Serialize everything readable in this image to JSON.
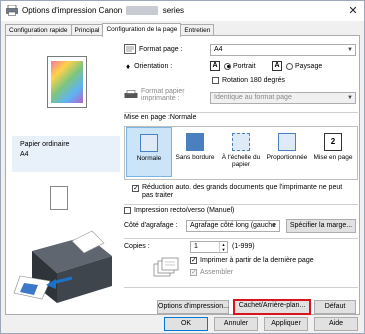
{
  "window": {
    "title_prefix": "Options d'impression Canon",
    "title_suffix": "series",
    "close": "✕"
  },
  "tabs": [
    "Configuration rapide",
    "Principal",
    "Configuration de la page",
    "Entretien"
  ],
  "preview": {
    "media_type": "Papier ordinaire",
    "paper_size": "A4"
  },
  "format": {
    "label": "Format page :",
    "value": "A4"
  },
  "orientation": {
    "label": "Orientation :",
    "portrait": "Portrait",
    "landscape": "Paysage",
    "rotate180": "Rotation 180 degrés"
  },
  "printer_paper": {
    "label_line1": "Format papier",
    "label_line2": "imprimante :",
    "value": "Identique au format page"
  },
  "layout": {
    "label": "Mise en page :Normale",
    "items": [
      "Normale",
      "Sans bordure",
      "À l'échelle du papier",
      "Proportionnée",
      "Mise en page"
    ]
  },
  "auto_reduce": "Réduction auto. des grands documents que l'imprimante ne peut pas traiter",
  "duplex": "Impression recto/verso (Manuel)",
  "stapling": {
    "label": "Côté d'agrafage :",
    "value": "Agrafage côté long (gauche",
    "margin_button": "Spécifier la marge..."
  },
  "copies": {
    "label": "Copies :",
    "value": "1",
    "range": "(1-999)",
    "from_last": "Imprimer à partir de la dernière page",
    "collate": "Assembler"
  },
  "buttons": {
    "print_options": "Options d'impression...",
    "stamp_background": "Cachet/Arrière-plan...",
    "defaults": "Défaut",
    "ok": "OK",
    "cancel": "Annuler",
    "apply": "Appliquer",
    "help": "Aide"
  }
}
